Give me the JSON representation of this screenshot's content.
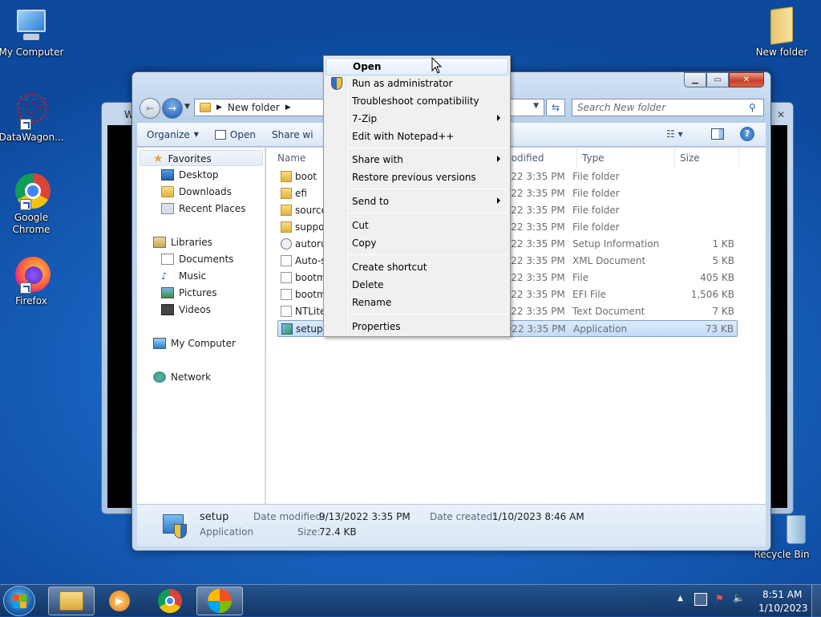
{
  "desktop": {
    "icons": [
      {
        "label": "My Computer"
      },
      {
        "label": "DataWagon..."
      },
      {
        "label": "Google Chrome"
      },
      {
        "label": "Firefox"
      },
      {
        "label": "New folder"
      },
      {
        "label": "Recycle Bin"
      }
    ]
  },
  "background_window": {
    "title_fragment": "W"
  },
  "explorer": {
    "breadcrumb": [
      "New folder"
    ],
    "search_placeholder": "Search New folder",
    "toolbar": {
      "organize": "Organize",
      "open": "Open",
      "share": "Share wi"
    },
    "nav": {
      "favorites": "Favorites",
      "desktop": "Desktop",
      "downloads": "Downloads",
      "recent": "Recent Places",
      "libraries": "Libraries",
      "documents": "Documents",
      "music": "Music",
      "pictures": "Pictures",
      "videos": "Videos",
      "computer": "My Computer",
      "network": "Network"
    },
    "columns": {
      "name": "Name",
      "modified": "modified",
      "type": "Type",
      "size": "Size"
    },
    "files": [
      {
        "name": "boot",
        "modified": "2022 3:35 PM",
        "type": "File folder",
        "size": ""
      },
      {
        "name": "efi",
        "modified": "2022 3:35 PM",
        "type": "File folder",
        "size": ""
      },
      {
        "name": "source",
        "modified": "2022 3:35 PM",
        "type": "File folder",
        "size": ""
      },
      {
        "name": "suppo",
        "modified": "2022 3:35 PM",
        "type": "File folder",
        "size": ""
      },
      {
        "name": "autoru",
        "modified": "2022 3:35 PM",
        "type": "Setup Information",
        "size": "1 KB"
      },
      {
        "name": "Auto-s",
        "modified": "2022 3:35 PM",
        "type": "XML Document",
        "size": "5 KB"
      },
      {
        "name": "bootm",
        "modified": "2022 3:35 PM",
        "type": "File",
        "size": "405 KB"
      },
      {
        "name": "bootm",
        "modified": "2022 3:35 PM",
        "type": "EFI File",
        "size": "1,506 KB"
      },
      {
        "name": "NTLite",
        "modified": "2022 3:35 PM",
        "type": "Text Document",
        "size": "7 KB"
      },
      {
        "name": "setup",
        "modified": "2022 3:35 PM",
        "type": "Application",
        "size": "73 KB"
      }
    ],
    "details": {
      "name": "setup",
      "kind": "Application",
      "modified_label": "Date modified:",
      "modified_value": "9/13/2022 3:35 PM",
      "size_label": "Size:",
      "size_value": "72.4 KB",
      "created_label": "Date created:",
      "created_value": "1/10/2023 8:46 AM"
    }
  },
  "context_menu": {
    "items": [
      {
        "label": "Open"
      },
      {
        "label": "Run as administrator"
      },
      {
        "label": "Troubleshoot compatibility"
      },
      {
        "label": "7-Zip"
      },
      {
        "label": "Edit with Notepad++"
      },
      {
        "label": "Share with"
      },
      {
        "label": "Restore previous versions"
      },
      {
        "label": "Send to"
      },
      {
        "label": "Cut"
      },
      {
        "label": "Copy"
      },
      {
        "label": "Create shortcut"
      },
      {
        "label": "Delete"
      },
      {
        "label": "Rename"
      },
      {
        "label": "Properties"
      }
    ]
  },
  "taskbar": {
    "time": "8:51 AM",
    "date": "1/10/2023"
  },
  "colors": {
    "accent": "#1b6ac9",
    "selection": "#c2dcf8",
    "menu_bg": "#f0f0f0"
  }
}
